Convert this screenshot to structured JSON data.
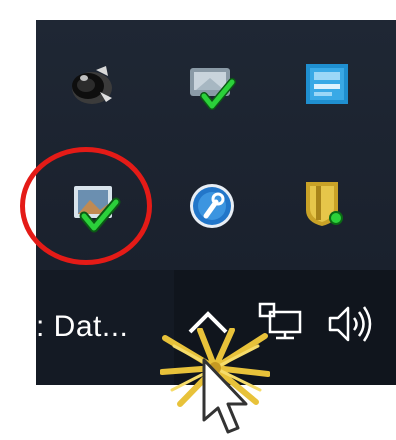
{
  "taskbar": {
    "app_button_label": ": Dat..."
  },
  "overflow_tray": {
    "icons": [
      {
        "name": "speaker-icon"
      },
      {
        "name": "sync-check-icon"
      },
      {
        "name": "intel-graphics-icon"
      },
      {
        "name": "photo-check-icon",
        "highlighted": true
      },
      {
        "name": "wrench-icon"
      },
      {
        "name": "shield-icon"
      }
    ]
  },
  "colors": {
    "highlight_circle": "#e41b17",
    "check_green": "#2bd13a",
    "starburst": "#e8c23a"
  }
}
